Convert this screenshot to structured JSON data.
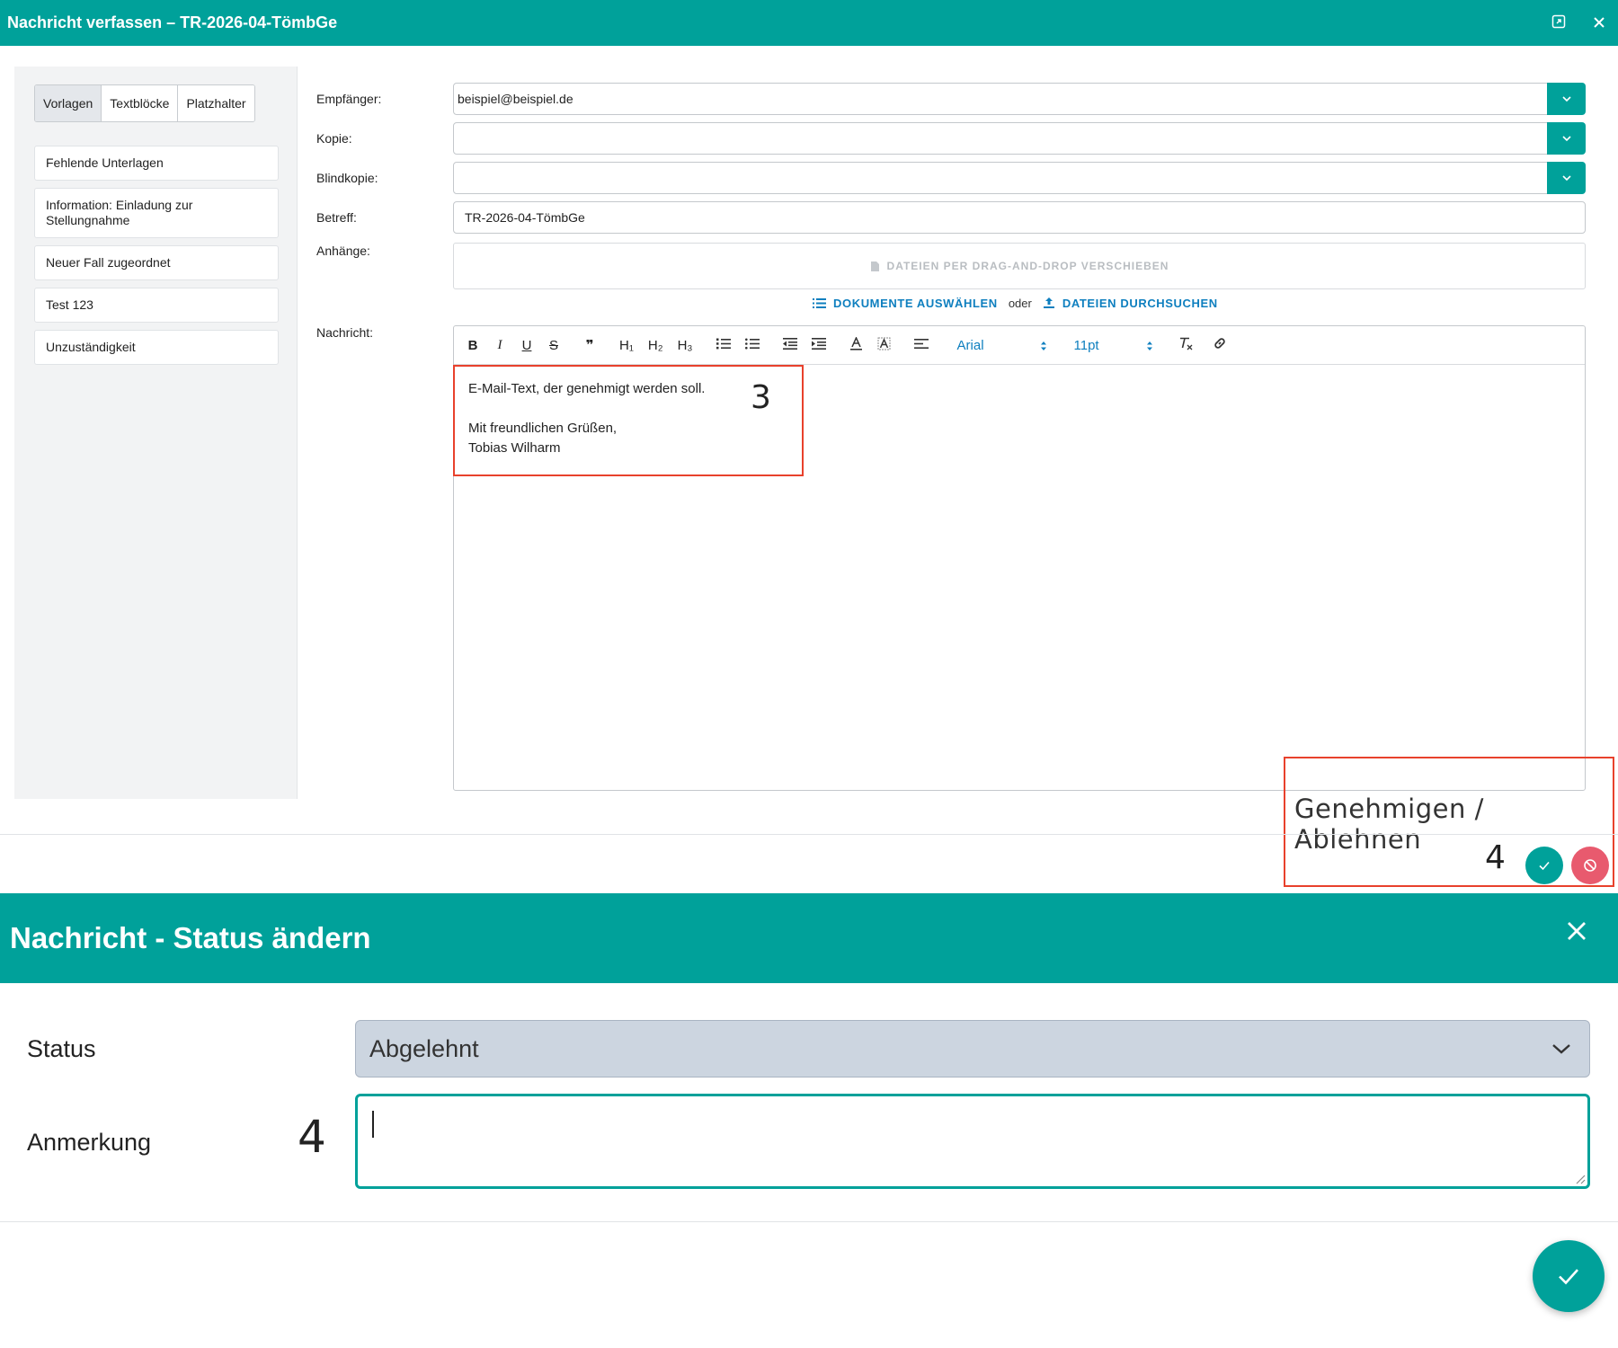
{
  "compose": {
    "title": "Nachricht verfassen – TR-2026-04-TömbGe",
    "tabs": [
      "Vorlagen",
      "Textblöcke",
      "Platzhalter"
    ],
    "templates": [
      "Fehlende Unterlagen",
      "Information: Einladung zur Stellungnahme",
      "Neuer Fall zugeordnet",
      "Test 123",
      "Unzuständigkeit"
    ],
    "labels": {
      "recipient": "Empfänger:",
      "cc": "Kopie:",
      "bcc": "Blindkopie:",
      "subject": "Betreff:",
      "attachments": "Anhänge:",
      "message": "Nachricht:"
    },
    "recipient_value": "beispiel@beispiel.de",
    "cc_value": "",
    "bcc_value": "",
    "subject_value": "TR-2026-04-TömbGe",
    "dropzone_text": "DATEIEN PER DRAG-AND-DROP VERSCHIEBEN",
    "select_docs": "DOKUMENTE AUSWÄHLEN",
    "or_text": "oder",
    "browse_files": "DATEIEN DURCHSUCHEN",
    "toolbar": {
      "bold": "B",
      "italic": "I",
      "underline": "U",
      "strike": "S",
      "quote": "❞",
      "h1": "H₁",
      "h2": "H₂",
      "h3": "H₃",
      "font": "Arial",
      "size": "11pt"
    },
    "body_lines": [
      "E-Mail-Text, der genehmigt werden soll.",
      "",
      "Mit freundlichen Grüßen,",
      "Tobias Wilharm"
    ],
    "annotation_3": "3",
    "approve_label": "Genehmigen / Ablehnen",
    "annotation_4a": "4"
  },
  "status_dialog": {
    "title": "Nachricht - Status ändern",
    "status_label": "Status",
    "status_value": "Abgelehnt",
    "note_label": "Anmerkung",
    "annotation_4b": "4",
    "note_value": ""
  },
  "colors": {
    "primary": "#00a19a",
    "danger": "#e85a6e",
    "highlight": "#e8412c",
    "link": "#0e7fbf"
  }
}
